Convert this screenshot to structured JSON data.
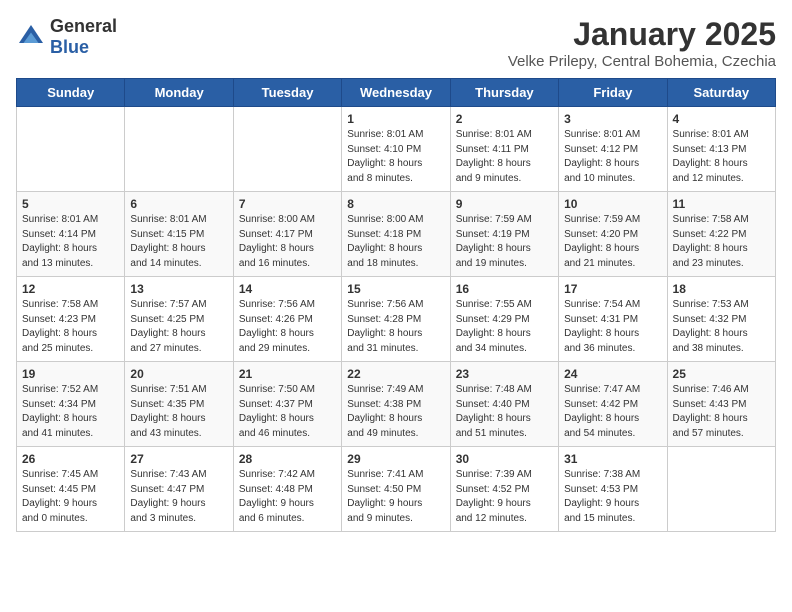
{
  "header": {
    "logo_general": "General",
    "logo_blue": "Blue",
    "month_title": "January 2025",
    "location": "Velke Prilepy, Central Bohemia, Czechia"
  },
  "days_of_week": [
    "Sunday",
    "Monday",
    "Tuesday",
    "Wednesday",
    "Thursday",
    "Friday",
    "Saturday"
  ],
  "weeks": [
    [
      {
        "day": "",
        "info": ""
      },
      {
        "day": "",
        "info": ""
      },
      {
        "day": "",
        "info": ""
      },
      {
        "day": "1",
        "info": "Sunrise: 8:01 AM\nSunset: 4:10 PM\nDaylight: 8 hours\nand 8 minutes."
      },
      {
        "day": "2",
        "info": "Sunrise: 8:01 AM\nSunset: 4:11 PM\nDaylight: 8 hours\nand 9 minutes."
      },
      {
        "day": "3",
        "info": "Sunrise: 8:01 AM\nSunset: 4:12 PM\nDaylight: 8 hours\nand 10 minutes."
      },
      {
        "day": "4",
        "info": "Sunrise: 8:01 AM\nSunset: 4:13 PM\nDaylight: 8 hours\nand 12 minutes."
      }
    ],
    [
      {
        "day": "5",
        "info": "Sunrise: 8:01 AM\nSunset: 4:14 PM\nDaylight: 8 hours\nand 13 minutes."
      },
      {
        "day": "6",
        "info": "Sunrise: 8:01 AM\nSunset: 4:15 PM\nDaylight: 8 hours\nand 14 minutes."
      },
      {
        "day": "7",
        "info": "Sunrise: 8:00 AM\nSunset: 4:17 PM\nDaylight: 8 hours\nand 16 minutes."
      },
      {
        "day": "8",
        "info": "Sunrise: 8:00 AM\nSunset: 4:18 PM\nDaylight: 8 hours\nand 18 minutes."
      },
      {
        "day": "9",
        "info": "Sunrise: 7:59 AM\nSunset: 4:19 PM\nDaylight: 8 hours\nand 19 minutes."
      },
      {
        "day": "10",
        "info": "Sunrise: 7:59 AM\nSunset: 4:20 PM\nDaylight: 8 hours\nand 21 minutes."
      },
      {
        "day": "11",
        "info": "Sunrise: 7:58 AM\nSunset: 4:22 PM\nDaylight: 8 hours\nand 23 minutes."
      }
    ],
    [
      {
        "day": "12",
        "info": "Sunrise: 7:58 AM\nSunset: 4:23 PM\nDaylight: 8 hours\nand 25 minutes."
      },
      {
        "day": "13",
        "info": "Sunrise: 7:57 AM\nSunset: 4:25 PM\nDaylight: 8 hours\nand 27 minutes."
      },
      {
        "day": "14",
        "info": "Sunrise: 7:56 AM\nSunset: 4:26 PM\nDaylight: 8 hours\nand 29 minutes."
      },
      {
        "day": "15",
        "info": "Sunrise: 7:56 AM\nSunset: 4:28 PM\nDaylight: 8 hours\nand 31 minutes."
      },
      {
        "day": "16",
        "info": "Sunrise: 7:55 AM\nSunset: 4:29 PM\nDaylight: 8 hours\nand 34 minutes."
      },
      {
        "day": "17",
        "info": "Sunrise: 7:54 AM\nSunset: 4:31 PM\nDaylight: 8 hours\nand 36 minutes."
      },
      {
        "day": "18",
        "info": "Sunrise: 7:53 AM\nSunset: 4:32 PM\nDaylight: 8 hours\nand 38 minutes."
      }
    ],
    [
      {
        "day": "19",
        "info": "Sunrise: 7:52 AM\nSunset: 4:34 PM\nDaylight: 8 hours\nand 41 minutes."
      },
      {
        "day": "20",
        "info": "Sunrise: 7:51 AM\nSunset: 4:35 PM\nDaylight: 8 hours\nand 43 minutes."
      },
      {
        "day": "21",
        "info": "Sunrise: 7:50 AM\nSunset: 4:37 PM\nDaylight: 8 hours\nand 46 minutes."
      },
      {
        "day": "22",
        "info": "Sunrise: 7:49 AM\nSunset: 4:38 PM\nDaylight: 8 hours\nand 49 minutes."
      },
      {
        "day": "23",
        "info": "Sunrise: 7:48 AM\nSunset: 4:40 PM\nDaylight: 8 hours\nand 51 minutes."
      },
      {
        "day": "24",
        "info": "Sunrise: 7:47 AM\nSunset: 4:42 PM\nDaylight: 8 hours\nand 54 minutes."
      },
      {
        "day": "25",
        "info": "Sunrise: 7:46 AM\nSunset: 4:43 PM\nDaylight: 8 hours\nand 57 minutes."
      }
    ],
    [
      {
        "day": "26",
        "info": "Sunrise: 7:45 AM\nSunset: 4:45 PM\nDaylight: 9 hours\nand 0 minutes."
      },
      {
        "day": "27",
        "info": "Sunrise: 7:43 AM\nSunset: 4:47 PM\nDaylight: 9 hours\nand 3 minutes."
      },
      {
        "day": "28",
        "info": "Sunrise: 7:42 AM\nSunset: 4:48 PM\nDaylight: 9 hours\nand 6 minutes."
      },
      {
        "day": "29",
        "info": "Sunrise: 7:41 AM\nSunset: 4:50 PM\nDaylight: 9 hours\nand 9 minutes."
      },
      {
        "day": "30",
        "info": "Sunrise: 7:39 AM\nSunset: 4:52 PM\nDaylight: 9 hours\nand 12 minutes."
      },
      {
        "day": "31",
        "info": "Sunrise: 7:38 AM\nSunset: 4:53 PM\nDaylight: 9 hours\nand 15 minutes."
      },
      {
        "day": "",
        "info": ""
      }
    ]
  ]
}
